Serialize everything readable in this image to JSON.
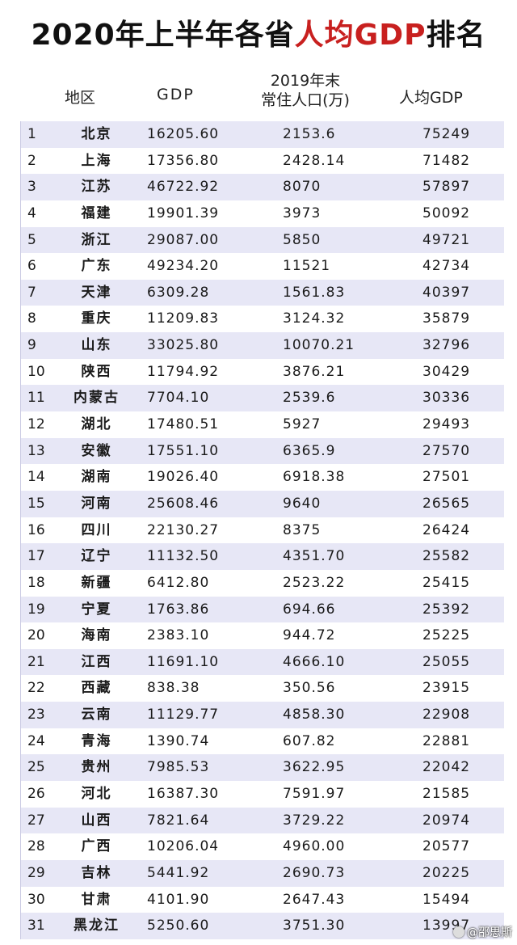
{
  "title": {
    "part1": "2020年上半年各省",
    "part2": "人均GDP",
    "part3": "排名",
    "highlight_color": "#c8201f"
  },
  "headers": {
    "region": "地区",
    "gdp": "GDP",
    "population_line1": "2019年末",
    "population_line2": "常住人口(万)",
    "per_capita": "人均GDP"
  },
  "rows": [
    {
      "rank": "1",
      "name": "北京",
      "gdp": "16205.60",
      "population": "2153.6",
      "per_capita": "75249"
    },
    {
      "rank": "2",
      "name": "上海",
      "gdp": "17356.80",
      "population": "2428.14",
      "per_capita": "71482"
    },
    {
      "rank": "3",
      "name": "江苏",
      "gdp": "46722.92",
      "population": "8070",
      "per_capita": "57897"
    },
    {
      "rank": "4",
      "name": "福建",
      "gdp": "19901.39",
      "population": "3973",
      "per_capita": "50092"
    },
    {
      "rank": "5",
      "name": "浙江",
      "gdp": "29087.00",
      "population": "5850",
      "per_capita": "49721"
    },
    {
      "rank": "6",
      "name": "广东",
      "gdp": "49234.20",
      "population": "11521",
      "per_capita": "42734"
    },
    {
      "rank": "7",
      "name": "天津",
      "gdp": "6309.28",
      "population": "1561.83",
      "per_capita": "40397"
    },
    {
      "rank": "8",
      "name": "重庆",
      "gdp": "11209.83",
      "population": "3124.32",
      "per_capita": "35879"
    },
    {
      "rank": "9",
      "name": "山东",
      "gdp": "33025.80",
      "population": "10070.21",
      "per_capita": "32796"
    },
    {
      "rank": "10",
      "name": "陕西",
      "gdp": "11794.92",
      "population": "3876.21",
      "per_capita": "30429"
    },
    {
      "rank": "11",
      "name": "内蒙古",
      "gdp": "7704.10",
      "population": "2539.6",
      "per_capita": "30336"
    },
    {
      "rank": "12",
      "name": "湖北",
      "gdp": "17480.51",
      "population": "5927",
      "per_capita": "29493"
    },
    {
      "rank": "13",
      "name": "安徽",
      "gdp": "17551.10",
      "population": "6365.9",
      "per_capita": "27570"
    },
    {
      "rank": "14",
      "name": "湖南",
      "gdp": "19026.40",
      "population": "6918.38",
      "per_capita": "27501"
    },
    {
      "rank": "15",
      "name": "河南",
      "gdp": "25608.46",
      "population": "9640",
      "per_capita": "26565"
    },
    {
      "rank": "16",
      "name": "四川",
      "gdp": "22130.27",
      "population": "8375",
      "per_capita": "26424"
    },
    {
      "rank": "17",
      "name": "辽宁",
      "gdp": "11132.50",
      "population": "4351.70",
      "per_capita": "25582"
    },
    {
      "rank": "18",
      "name": "新疆",
      "gdp": "6412.80",
      "population": "2523.22",
      "per_capita": "25415"
    },
    {
      "rank": "19",
      "name": "宁夏",
      "gdp": "1763.86",
      "population": "694.66",
      "per_capita": "25392"
    },
    {
      "rank": "20",
      "name": "海南",
      "gdp": "2383.10",
      "population": "944.72",
      "per_capita": "25225"
    },
    {
      "rank": "21",
      "name": "江西",
      "gdp": "11691.10",
      "population": "4666.10",
      "per_capita": "25055"
    },
    {
      "rank": "22",
      "name": "西藏",
      "gdp": "838.38",
      "population": "350.56",
      "per_capita": "23915"
    },
    {
      "rank": "23",
      "name": "云南",
      "gdp": "11129.77",
      "population": "4858.30",
      "per_capita": "22908"
    },
    {
      "rank": "24",
      "name": "青海",
      "gdp": "1390.74",
      "population": "607.82",
      "per_capita": "22881"
    },
    {
      "rank": "25",
      "name": "贵州",
      "gdp": "7985.53",
      "population": "3622.95",
      "per_capita": "22042"
    },
    {
      "rank": "26",
      "name": "河北",
      "gdp": "16387.30",
      "population": "7591.97",
      "per_capita": "21585"
    },
    {
      "rank": "27",
      "name": "山西",
      "gdp": "7821.64",
      "population": "3729.22",
      "per_capita": "20974"
    },
    {
      "rank": "28",
      "name": "广西",
      "gdp": "10206.04",
      "population": "4960.00",
      "per_capita": "20577"
    },
    {
      "rank": "29",
      "name": "吉林",
      "gdp": "5441.92",
      "population": "2690.73",
      "per_capita": "20225"
    },
    {
      "rank": "30",
      "name": "甘肃",
      "gdp": "4101.90",
      "population": "2647.43",
      "per_capita": "15494"
    },
    {
      "rank": "31",
      "name": "黑龙江",
      "gdp": "5250.60",
      "population": "3751.30",
      "per_capita": "13997"
    }
  ],
  "watermark": {
    "text": "@邵思斯",
    "icon": "weibo-icon"
  }
}
